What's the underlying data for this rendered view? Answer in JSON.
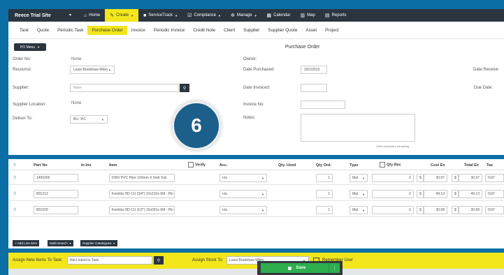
{
  "nav": {
    "site": "Reece Trial Site",
    "items": [
      {
        "icon": "home-icon",
        "label": "Home"
      },
      {
        "icon": "pencil-icon",
        "label": "Create"
      },
      {
        "icon": "truck-icon",
        "label": "ServiceTrack"
      },
      {
        "icon": "check-square-icon",
        "label": "Compliance"
      },
      {
        "icon": "gear-icon",
        "label": "Manage"
      },
      {
        "icon": "calendar-icon",
        "label": "Calendar"
      },
      {
        "icon": "map-icon",
        "label": "Map"
      },
      {
        "icon": "chart-icon",
        "label": "Reports"
      }
    ]
  },
  "tabs": [
    "Task",
    "Quote",
    "Periodic Task",
    "Purchase Order",
    "Invoice",
    "Periodic Invoice",
    "Credit Note",
    "Client",
    "Supplier",
    "Supplier Quote",
    "Asset",
    "Project"
  ],
  "form": {
    "po_menu": "PO Menu",
    "title": "Purchase Order",
    "order_no_label": "Order No:",
    "order_no_value": "None",
    "resource_label": "Resource:",
    "resource_value": "Luisa Bradshaw-Wiley",
    "supplier_label": "Supplier:",
    "supplier_placeholder": "None",
    "supplier_location_label": "Supplier Location:",
    "supplier_location_value": "None",
    "deliver_to_label": "Deliver To:",
    "deliver_to_value": "BU: VIC",
    "owner_label": "Owner:",
    "date_purchased_label": "Date Purchased:",
    "date_purchased_value": "23/1/2019",
    "date_invoiced_label": "Date Invoiced:",
    "invoice_no_label": "Invoice No:",
    "notes_label": "Notes:",
    "notes_remaining": "1000 characters remaining",
    "date_received_label": "Date Receive",
    "due_date_label": "Due Date:"
  },
  "badge": "6",
  "grid": {
    "headers": {
      "part_no": "Part No",
      "in_inv": "In Inv.",
      "item": "Item",
      "verify": "Verify",
      "acc": "Acc.",
      "qty_used": "Qty. Used",
      "qty_ord": "Qty Ord.",
      "type": "Type",
      "qty_rec": "Qty Rec",
      "cost_ex": "Cost Ex",
      "total_ex": "Total Ex",
      "tax": "Tax"
    },
    "rows": [
      {
        "part_no": "1400200",
        "item": "DWV PVC Pipe 100mm X 6mtr Sck",
        "acc": "n/a",
        "qty_ord": "1",
        "type": "Mat",
        "qty_rec": "0",
        "currency": "$",
        "cost_ex": "30.97",
        "total_ex": "30.97",
        "tax": "GST"
      },
      {
        "part_no": "801213",
        "item": "Kembla HD CU (3/4\") 22x102x 6M - Pin",
        "acc": "n/a",
        "qty_ord": "1",
        "type": "Mat",
        "qty_rec": "0",
        "currency": "$",
        "cost_ex": "49.13",
        "total_ex": "49.13",
        "tax": "GST"
      },
      {
        "part_no": "801020",
        "item": "Kembla HD CU (1/2\") 15x091x 6M - Pin",
        "acc": "n/a",
        "qty_ord": "1",
        "type": "Mat",
        "qty_rec": "0",
        "currency": "$",
        "cost_ex": "30.68",
        "total_ex": "30.68",
        "tax": "GST"
      }
    ],
    "buttons": {
      "add_line": "+ Add Line Item",
      "multi_search": "Multi-Search",
      "supplier_catalogues": "Supplier Catalogues"
    }
  },
  "assign": {
    "new_items_label": "Assign New Items To Task:",
    "task_value": "Not Linked to Task",
    "stock_label": "Assign Stock To:",
    "stock_value": "Luisa Bradshaw-Wiley",
    "remember_label": "Remember User"
  },
  "save_label": "Save"
}
